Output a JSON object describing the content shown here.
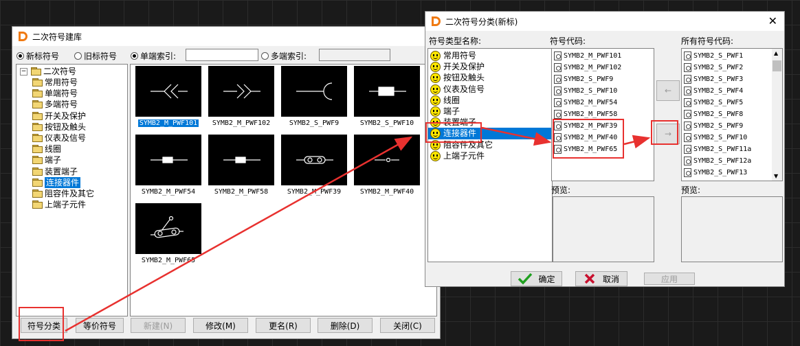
{
  "left_window": {
    "title": "二次符号建库",
    "radio_new": "新标符号",
    "radio_old": "旧标符号",
    "radio_single": "单端索引:",
    "radio_multi": "多端索引:",
    "tree": {
      "root": "二次符号",
      "children": [
        "常用符号",
        "单端符号",
        "多端符号",
        "开关及保护",
        "按钮及触头",
        "仪表及信号",
        "线圈",
        "端子",
        "装置端子",
        "连接器件",
        "阻容件及其它",
        "上端子元件"
      ],
      "selected": "连接器件"
    },
    "thumbs": [
      "SYMB2_M_PWF101",
      "SYMB2_M_PWF102",
      "SYMB2_S_PWF9",
      "SYMB2_S_PWF10",
      "SYMB2_M_PWF54",
      "SYMB2_M_PWF58",
      "SYMB2_M_PWF39",
      "SYMB2_M_PWF40",
      "SYMB2_M_PWF65"
    ],
    "buttons": {
      "classify": "符号分类",
      "equivalent": "等价符号",
      "new": "新建(N)",
      "modify": "修改(M)",
      "rename": "更名(R)",
      "delete": "删除(D)",
      "close": "关闭(C)"
    }
  },
  "right_window": {
    "title": "二次符号分类(新标)",
    "close_glyph": "✕",
    "col_type": "符号类型名称:",
    "col_code": "符号代码:",
    "col_all": "所有符号代码:",
    "types": [
      "常用符号",
      "开关及保护",
      "按钮及触头",
      "仪表及信号",
      "线圈",
      "端子",
      "装置端子",
      "连接器件",
      "阻容件及其它",
      "上端子元件"
    ],
    "selected_type": "连接器件",
    "codes": [
      "SYMB2_M_PWF101",
      "SYMB2_M_PWF102",
      "SYMB2_S_PWF9",
      "SYMB2_S_PWF10",
      "SYMB2_M_PWF54",
      "SYMB2_M_PWF58",
      "SYMB2_M_PWF39",
      "SYMB2_M_PWF40",
      "SYMB2_M_PWF65"
    ],
    "all_codes": [
      "SYMB2_S_PWF1",
      "SYMB2_S_PWF2",
      "SYMB2_S_PWF3",
      "SYMB2_S_PWF4",
      "SYMB2_S_PWF5",
      "SYMB2_S_PWF8",
      "SYMB2_S_PWF9",
      "SYMB2_S_PWF10",
      "SYMB2_S_PWF11a",
      "SYMB2_S_PWF12a",
      "SYMB2_S_PWF13"
    ],
    "move_left": "←",
    "move_right": "→",
    "preview_left": "预览:",
    "preview_right": "预览:",
    "ok": "确定",
    "cancel": "取消",
    "apply": "应用"
  },
  "colors": {
    "selection": "#0078d7",
    "annotation_red": "#e8312f",
    "ok_green": "#1fa01f",
    "cancel_red": "#c8102e"
  }
}
